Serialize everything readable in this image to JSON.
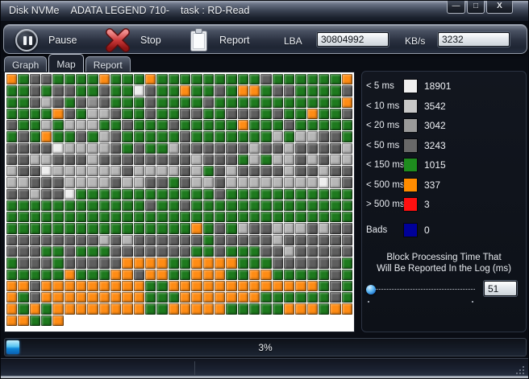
{
  "window": {
    "title_parts": [
      "Disk NVMe",
      "ADATA LEGEND 710-",
      "task : RD-Read"
    ],
    "controls": [
      {
        "name": "minimize",
        "glyph": "—"
      },
      {
        "name": "maximize",
        "glyph": "□"
      },
      {
        "name": "close",
        "glyph": "X"
      }
    ]
  },
  "toolbar": {
    "pause": "Pause",
    "stop": "Stop",
    "report": "Report",
    "lba_label": "LBA",
    "lba_value": "30804992",
    "kbs_label": "KB/s",
    "kbs_value": "3232"
  },
  "tabs": [
    {
      "label": "Graph",
      "active": false
    },
    {
      "label": "Map",
      "active": true
    },
    {
      "label": "Report",
      "active": false
    }
  ],
  "legend": [
    {
      "label": "< 5 ms",
      "count": "18901",
      "color": "#f0f0f0"
    },
    {
      "label": "< 10 ms",
      "count": "3542",
      "color": "#c8c8c8"
    },
    {
      "label": "< 20 ms",
      "count": "3042",
      "color": "#9a9a9a"
    },
    {
      "label": "< 50 ms",
      "count": "3243",
      "color": "#686868"
    },
    {
      "label": "< 150 ms",
      "count": "1015",
      "color": "#1e8c1e"
    },
    {
      "label": "< 500 ms",
      "count": "337",
      "color": "#ff8c00"
    },
    {
      "label": "> 500 ms",
      "count": "3",
      "color": "#ff1010"
    },
    {
      "label": "Bads",
      "count": "0",
      "color": "#000099",
      "gap_before": true
    }
  ],
  "block_time": {
    "caption": [
      "Block Processing Time That",
      "Will Be Reported In the Log (ms)"
    ],
    "value": "51",
    "slider_fraction": 0.0
  },
  "progress": {
    "label": "3%",
    "fraction": 0.025
  },
  "map": {
    "palette": {
      "G": "#1e7a1e",
      "D": "#5e5e5e",
      "M": "#8f8f8f",
      "L": "#b7b7b7",
      "W": "#eeeeee",
      "O": "#ff8c14"
    },
    "rows": [
      "OGDDGGGGOGGGOGGGGGGGGGDGGGGGGO",
      "GGDGDDGGDGGWDGGOGGDGOOGDDGGGGD",
      "GGDLDGDMDGGGDGGGGDGGGGGGGGGGGO",
      "GGGGODGLLDGGDGGDDGGDDDGDGGOGGD",
      "DGGLGLLLGGDGGGDGGGGGOGGGDGGGGG",
      "GDGOGGDGLDGGGGGDGGGGGGGLGLLDDG",
      "DDDDWLLLLDGDGGLDDDDDDLDDLDDDDL",
      "DDLLDDDLDDDDDDDDLDDDGLGLLDLDLL",
      "LDDWLLLLLLDLLLLDLGDLDDDDLDDLDD",
      "LLDDDLLLLDLLDDGDLLDLLLLLLLLWLD",
      "DDLDDWGGGGGGGGGGGGDGGGGGGGGGGG",
      "GGGGGGGGGGGGDGGDGGGGGGGGGGGGGG",
      "GGGGGGGGGGGGGGGGGGGGGGGGGGGGGG",
      "GGGGGGGGGGGGGGGGOGDGLDDLLLDLDD",
      "DDDDDDDDLDLDDDDDDGDDDDDLDDDDDD",
      "DDDGGDGGGDDDDDDDGGDGGGDDLDDDDD",
      "GDDDGDDDDDOOOOGGOOOOGGGDDDDDDG",
      "GGGGGOGGGOODOOGGOOOGGOOGGGGGDG",
      "OODOOOOOOOOOGGOOOOOOOOOOOOOGDG",
      "OGDOOOOOOOOOGGGOOOOOOOGGGGGGDG",
      "OGOGOOOOOOOOGGOOOOOGGGGGOOOGOO",
      "OOGGO........................."
    ]
  }
}
